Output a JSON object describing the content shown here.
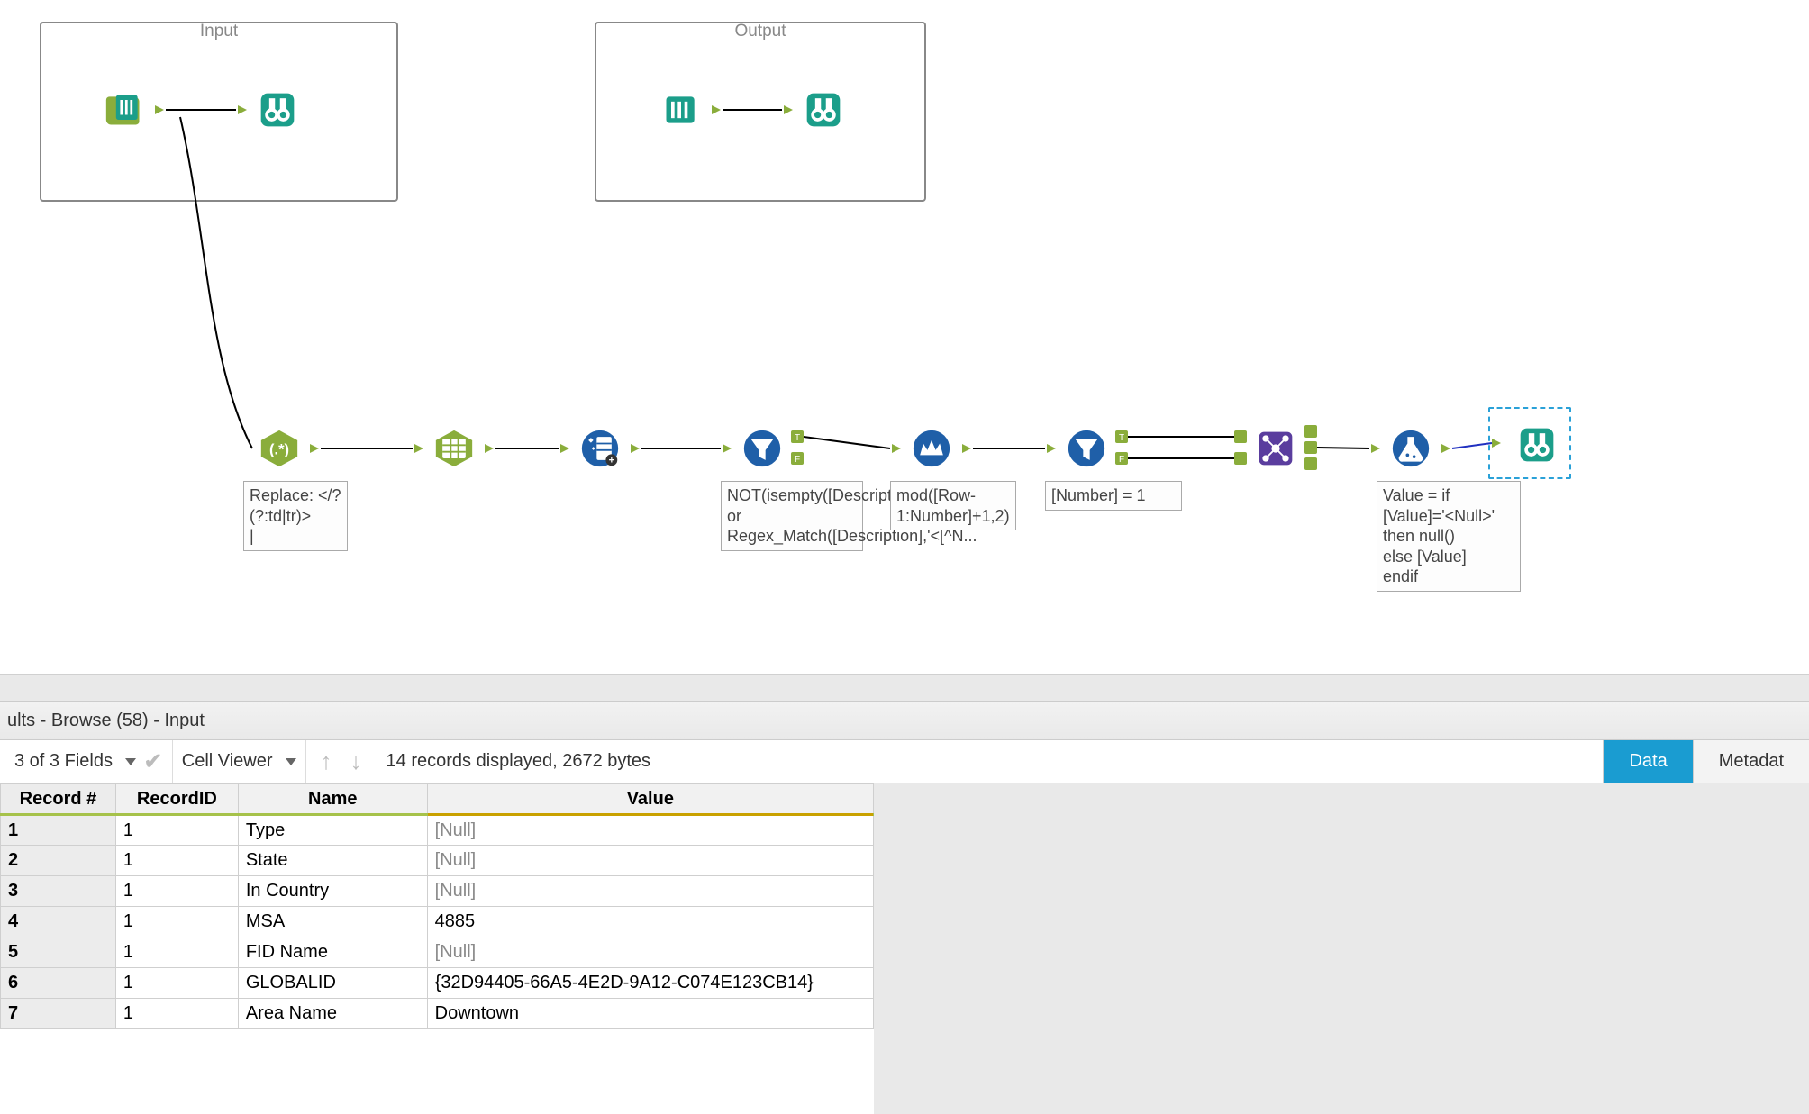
{
  "containers": {
    "input_label": "Input",
    "output_label": "Output"
  },
  "annotations": {
    "regex": "Replace: </?(?:td|tr)>\n|",
    "filter1": "NOT(isempty([Description]) or Regex_Match([Description],'<[^N...",
    "multirow": "mod([Row-1:Number]+1,2)",
    "filter2": "[Number] = 1",
    "formula": "Value = if [Value]='<Null>'\nthen null()\nelse [Value]\nendif"
  },
  "results": {
    "title": "ults - Browse (58) - Input",
    "fields_label": "3 of 3 Fields",
    "cell_viewer_label": "Cell Viewer",
    "status": "14 records displayed, 2672 bytes",
    "tab_data": "Data",
    "tab_metadata": "Metadat"
  },
  "grid": {
    "headers": {
      "rownum": "Record #",
      "recordid": "RecordID",
      "name": "Name",
      "value": "Value"
    },
    "rows": [
      {
        "num": "1",
        "recordid": "1",
        "name": "Type",
        "value": "[Null]",
        "isnull": true
      },
      {
        "num": "2",
        "recordid": "1",
        "name": "State",
        "value": "[Null]",
        "isnull": true
      },
      {
        "num": "3",
        "recordid": "1",
        "name": "In Country",
        "value": "[Null]",
        "isnull": true
      },
      {
        "num": "4",
        "recordid": "1",
        "name": "MSA",
        "value": "4885",
        "isnull": false
      },
      {
        "num": "5",
        "recordid": "1",
        "name": "FID Name",
        "value": "[Null]",
        "isnull": true
      },
      {
        "num": "6",
        "recordid": "1",
        "name": "GLOBALID",
        "value": "{32D94405-66A5-4E2D-9A12-C074E123CB14}",
        "isnull": false
      },
      {
        "num": "7",
        "recordid": "1",
        "name": "Area Name",
        "value": "Downtown",
        "isnull": false
      }
    ]
  },
  "colors": {
    "green": "#8aad3b",
    "teal": "#1b9e8a",
    "blue": "#1f5fa8",
    "purple": "#5a3d9e",
    "tab": "#1a9cd1"
  }
}
